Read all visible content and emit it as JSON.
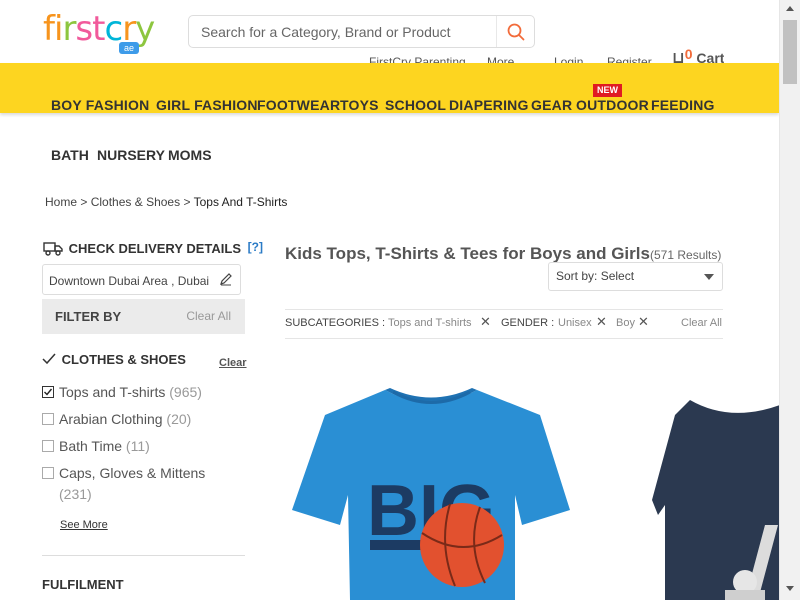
{
  "header": {
    "logo_letters": [
      "f",
      "i",
      "r",
      "s",
      "t",
      "c",
      "r",
      "y"
    ],
    "logo_colors": [
      "#f7941d",
      "#f7941d",
      "#8dc63f",
      "#f15a9b",
      "#f15a9b",
      "#00b5d8",
      "#f7941d",
      "#8dc63f"
    ],
    "logo_badge": "ae",
    "search_placeholder": "Search for a Category, Brand or Product",
    "top_links": [
      "FirstCry Parenting",
      "More",
      "Login",
      "Register"
    ],
    "cart_count": "0",
    "cart_label": "Cart"
  },
  "nav": {
    "items_row1": [
      "BOY FASHION",
      "GIRL FASHION",
      "FOOTWEAR",
      "TOYS",
      "SCHOOL",
      "DIAPERING",
      "GEAR",
      "OUTDOOR",
      "FEEDING"
    ],
    "items_row2": [
      "BATH",
      "NURSERY",
      "MOMS"
    ],
    "new_badge": "NEW",
    "band_color": "#fdd520"
  },
  "breadcrumb": {
    "items": [
      "Home",
      "Clothes & Shoes"
    ],
    "separator": ">",
    "current": "Tops And T-Shirts"
  },
  "sidebar": {
    "delivery_title": "CHECK DELIVERY DETAILS",
    "delivery_help": "[?]",
    "location": "Downtown Dubai Area , Dubai",
    "filter_by": "FILTER BY",
    "clear_all": "Clear All",
    "section_title": "CLOTHES & SHOES",
    "section_clear": "Clear",
    "options": [
      {
        "label": "Tops and T-shirts",
        "count": "(965)",
        "checked": true
      },
      {
        "label": "Arabian Clothing",
        "count": "(20)",
        "checked": false
      },
      {
        "label": "Bath Time",
        "count": "(11)",
        "checked": false
      },
      {
        "label": "Caps, Gloves & Mittens",
        "count": "(231)",
        "checked": false
      }
    ],
    "see_more": "See More",
    "fulfilment": "FULFILMENT"
  },
  "main": {
    "title": "Kids Tops, T-Shirts & Tees for Boys and Girls",
    "results": "(571 Results)",
    "sort_label": "Sort by:",
    "sort_value": "Select",
    "filters": {
      "subcat_label": "SUBCATEGORIES :",
      "subcat_value": "Tops and T-shirts",
      "gender_label": "GENDER :",
      "gender_values": [
        "Unisex",
        "Boy"
      ],
      "clear_all": "Clear All"
    },
    "product1_print": "BIG",
    "product1_color": "#2a8fd4",
    "product2_color": "#2b3950"
  }
}
